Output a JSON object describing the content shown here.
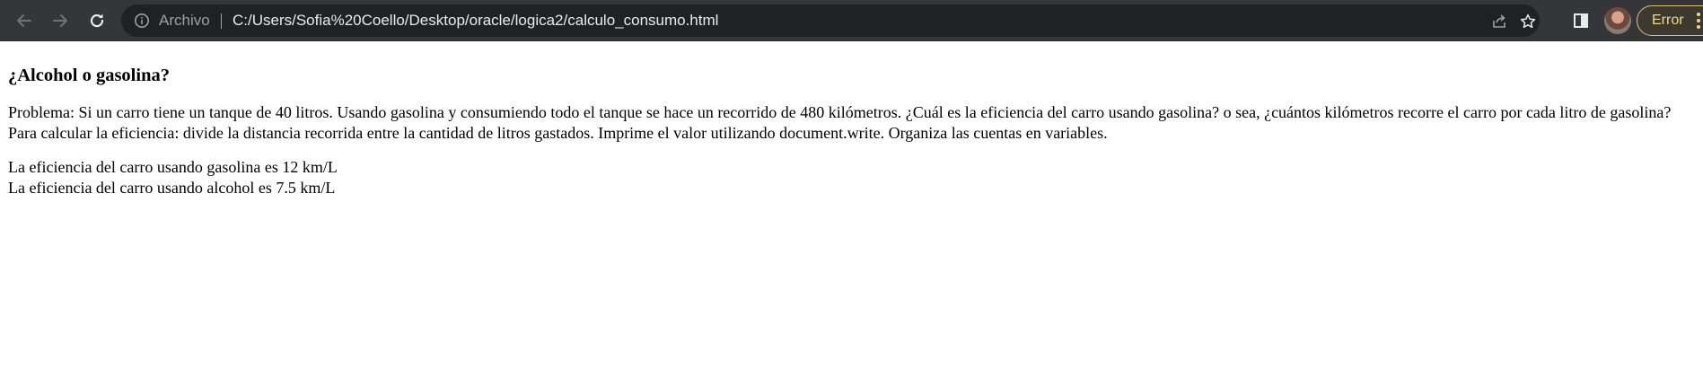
{
  "browser": {
    "omnibox": {
      "scheme_label": "Archivo",
      "url": "C:/Users/Sofia%20Coello/Desktop/oracle/logica2/calculo_consumo.html"
    },
    "profile_error_label": "Error"
  },
  "icons": {
    "back": "arrow-left-icon",
    "forward": "arrow-right-icon",
    "reload": "reload-icon",
    "info": "info-icon",
    "share": "share-icon",
    "bookmark": "star-icon",
    "side_panel": "side-panel-icon",
    "menu": "kebab-menu-icon"
  },
  "colors": {
    "toolbar_bg": "#35363a",
    "omnibox_bg": "#202124",
    "url_text": "#e8eaed",
    "error_accent": "#f2d78b"
  },
  "page": {
    "heading": "¿Alcohol o gasolina?",
    "problem": "Problema: Si un carro tiene un tanque de 40 litros. Usando gasolina y consumiendo todo el tanque se hace un recorrido de 480 kilómetros. ¿Cuál es la eficiencia del carro usando gasolina? o sea, ¿cuántos kilómetros recorre el carro por cada litro de gasolina? Para calcular la eficiencia: divide la distancia recorrida entre la cantidad de litros gastados. Imprime el valor utilizando document.write. Organiza las cuentas en variables.",
    "results": [
      "La eficiencia del carro usando gasolina es 12 km/L",
      "La eficiencia del carro usando alcohol es 7.5 km/L"
    ]
  }
}
